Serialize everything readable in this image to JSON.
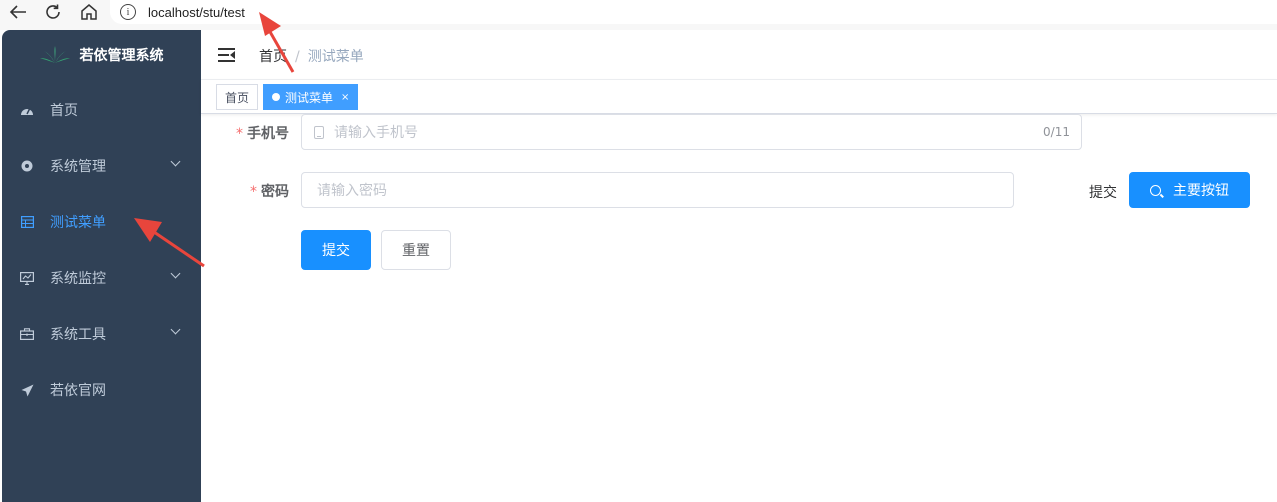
{
  "browser": {
    "url": "localhost/stu/test",
    "back_icon": "arrow-left-icon",
    "reload_icon": "reload-icon",
    "home_icon": "home-icon"
  },
  "sidebar": {
    "logo_title": "若依管理系统",
    "items": [
      {
        "label": "首页",
        "icon": "dashboard-icon"
      },
      {
        "label": "系统管理",
        "icon": "gear-icon"
      },
      {
        "label": "测试菜单",
        "icon": "table-icon"
      },
      {
        "label": "系统监控",
        "icon": "monitor-icon"
      },
      {
        "label": "系统工具",
        "icon": "toolbox-icon"
      },
      {
        "label": "若依官网",
        "icon": "paper-plane-icon"
      }
    ]
  },
  "header": {
    "breadcrumb": [
      "首页",
      "测试菜单"
    ],
    "separator": "/"
  },
  "tags": [
    {
      "label": "首页"
    },
    {
      "label": "测试菜单"
    }
  ],
  "form": {
    "phone": {
      "label": "手机号",
      "required_mark": "*",
      "placeholder": "请输入手机号",
      "count": "0/11"
    },
    "password": {
      "label": "密码",
      "required_mark": "*",
      "placeholder": "请输入密码"
    },
    "inline_submit_text": "提交",
    "primary_button": "主要按钮",
    "submit_button": "提交",
    "reset_button": "重置"
  },
  "colors": {
    "sidebar_bg": "#304156",
    "sidebar_text": "#bfcbd9",
    "active": "#409eff",
    "primary": "#1890ff",
    "required": "#f56c6c"
  }
}
